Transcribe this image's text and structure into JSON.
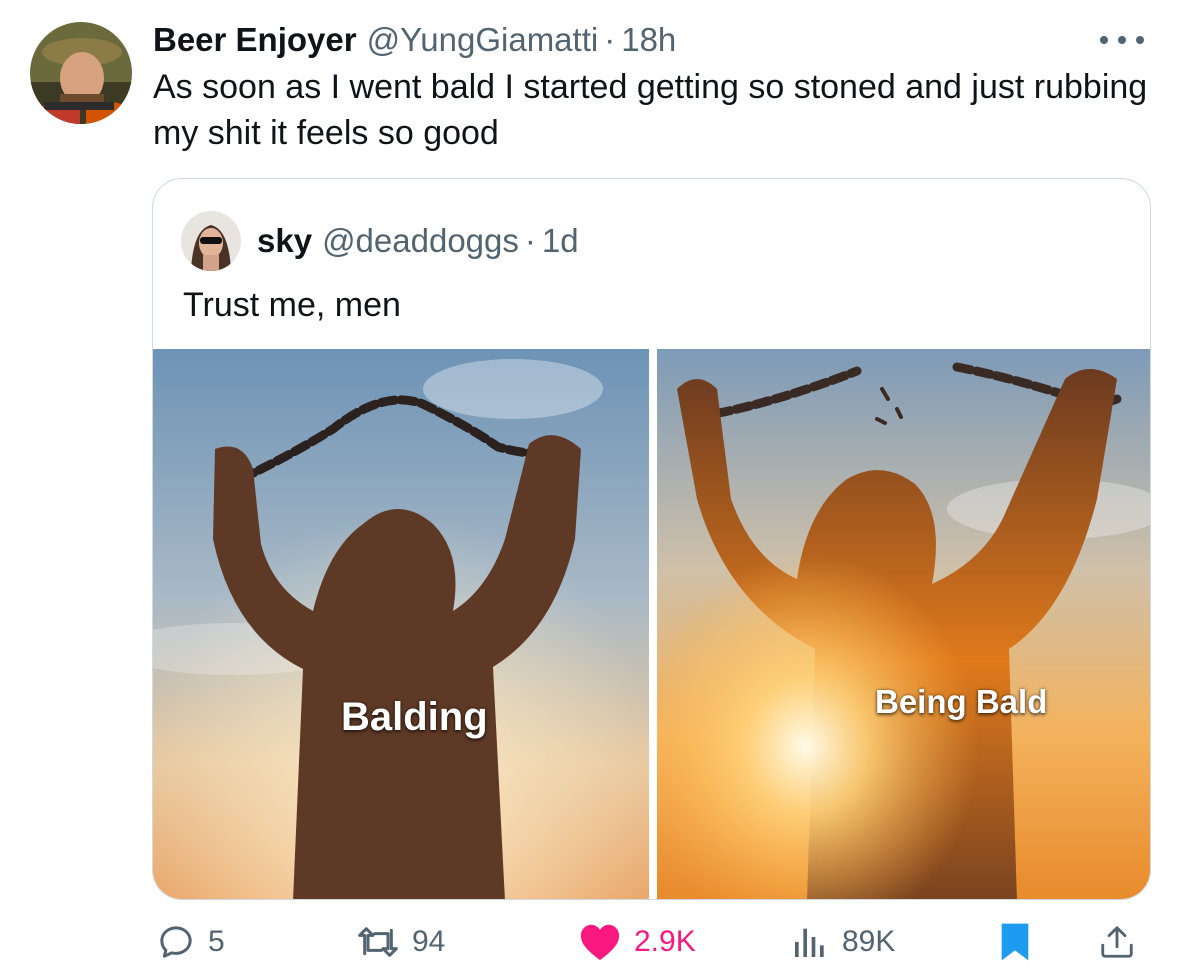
{
  "tweet": {
    "author": {
      "display_name": "Beer Enjoyer",
      "handle": "@YungGiamatti",
      "separator": "·",
      "time": "18h",
      "avatar": "profile-photo"
    },
    "more_icon": "more-horizontal-icon",
    "text": "As soon as I went bald I started getting so stoned and just rubbing my shit it feels so good",
    "quoted": {
      "author": {
        "display_name": "sky",
        "handle": "@deaddoggs",
        "separator": "·",
        "time": "1d",
        "avatar": "profile-photo"
      },
      "text": "Trust me, men",
      "media": [
        {
          "caption": "Balding"
        },
        {
          "caption": "Being Bald"
        }
      ]
    },
    "actions": {
      "reply": {
        "icon": "reply-icon",
        "count": "5"
      },
      "retweet": {
        "icon": "retweet-icon",
        "count": "94"
      },
      "like": {
        "icon": "heart-icon",
        "count": "2.9K",
        "active": true,
        "color": "#f91880"
      },
      "views": {
        "icon": "views-icon",
        "count": "89K"
      },
      "bookmark": {
        "icon": "bookmark-icon",
        "active": true,
        "color": "#1d9bf0"
      },
      "share": {
        "icon": "share-icon"
      }
    }
  }
}
